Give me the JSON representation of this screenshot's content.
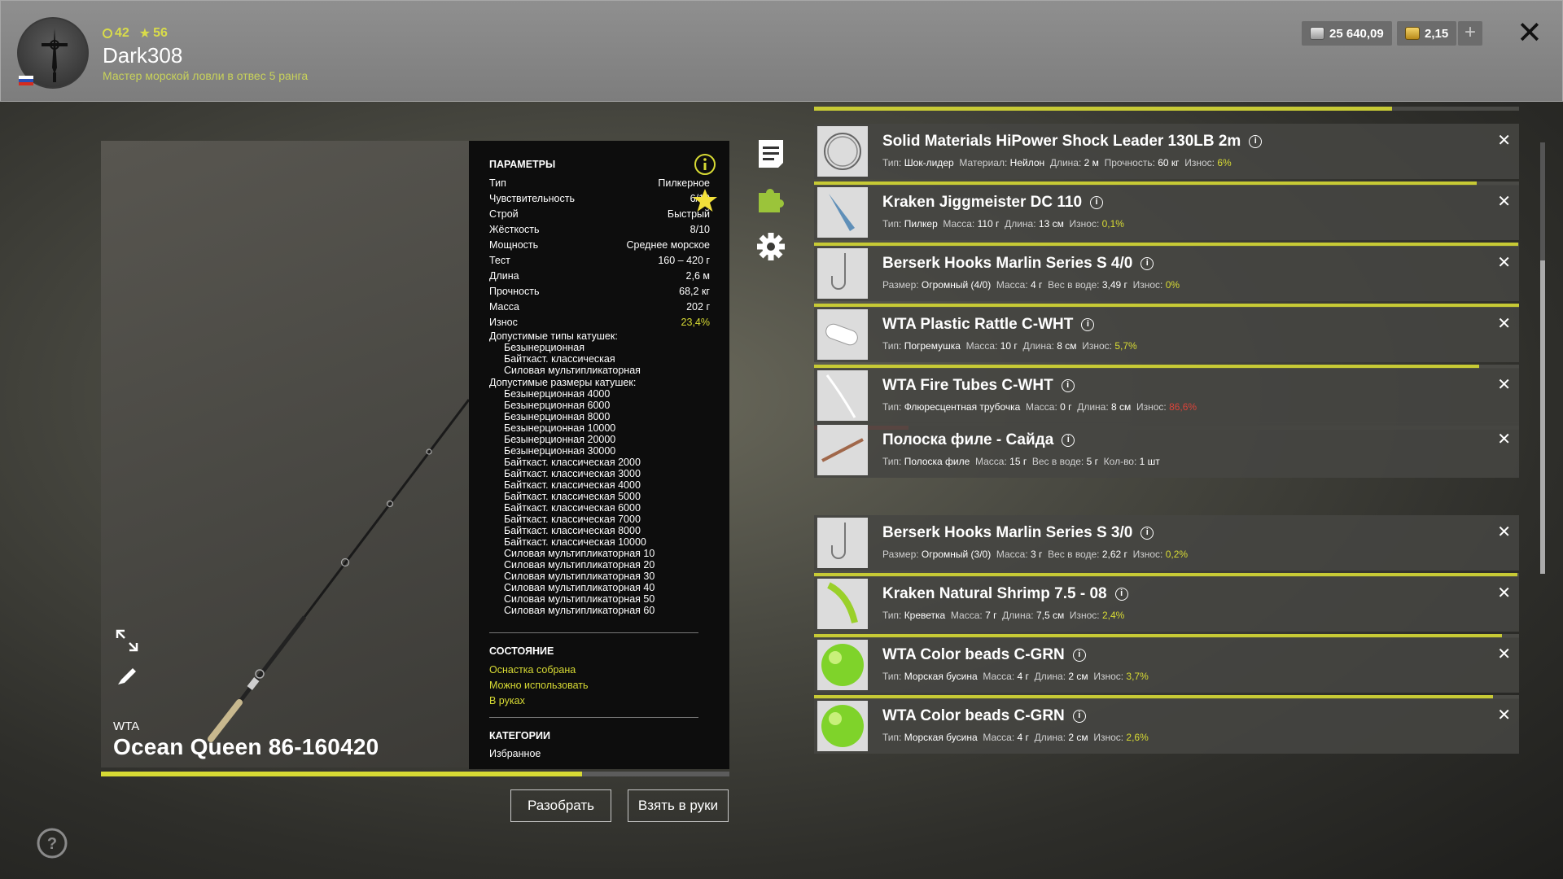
{
  "header": {
    "level": "42",
    "rating": "56",
    "username": "Dark308",
    "rank": "Мастер морской ловли в отвес 5 ранга",
    "silver": "25 640,09",
    "gold": "2,15"
  },
  "rod": {
    "brand": "WTA",
    "name": "Ocean Queen 86-160420",
    "condition_fraction": 0.766
  },
  "params": {
    "title": "ПАРАМЕТРЫ",
    "rows": [
      {
        "label": "Тип",
        "value": "Пилкерное"
      },
      {
        "label": "Чувствительность",
        "value": "6/10"
      },
      {
        "label": "Строй",
        "value": "Быстрый"
      },
      {
        "label": "Жёсткость",
        "value": "8/10"
      },
      {
        "label": "Мощность",
        "value": "Среднее морское"
      },
      {
        "label": "Тест",
        "value": "160 – 420 г"
      },
      {
        "label": "Длина",
        "value": "2,6 м"
      },
      {
        "label": "Прочность",
        "value": "68,2 кг"
      },
      {
        "label": "Масса",
        "value": "202 г"
      },
      {
        "label": "Износ",
        "value": "23,4%"
      }
    ],
    "reel_types_title": "Допустимые типы катушек:",
    "reel_types": [
      "Безынерционная",
      "Байткаст. классическая",
      "Силовая мультипликаторная"
    ],
    "reel_sizes_title": "Допустимые размеры катушек:",
    "reel_sizes": [
      "Безынерционная 4000",
      "Безынерционная 6000",
      "Безынерционная 8000",
      "Безынерционная 10000",
      "Безынерционная 20000",
      "Безынерционная 30000",
      "Байткаст. классическая 2000",
      "Байткаст. классическая 3000",
      "Байткаст. классическая 4000",
      "Байткаст. классическая 5000",
      "Байткаст. классическая 6000",
      "Байткаст. классическая 7000",
      "Байткаст. классическая 8000",
      "Байткаст. классическая 10000",
      "Силовая мультипликаторная 10",
      "Силовая мультипликаторная 20",
      "Силовая мультипликаторная 30",
      "Силовая мультипликаторная 40",
      "Силовая мультипликаторная 50",
      "Силовая мультипликаторная 60"
    ],
    "state_title": "СОСТОЯНИЕ",
    "state_items": [
      "Оснастка собрана",
      "Можно использовать",
      "В руках"
    ],
    "categories_title": "КАТЕГОРИИ",
    "category": "Избранное"
  },
  "buttons": {
    "disassemble": "Разобрать",
    "take": "Взять в руки"
  },
  "tackle": [
    {
      "name": "Solid Materials HiPower Shock Leader 130LB 2m",
      "desc": [
        [
          "Тип:",
          "Шок-лидер"
        ],
        [
          "Материал:",
          "Нейлон"
        ],
        [
          "Длина:",
          "2 м"
        ],
        [
          "Прочность:",
          "60 кг"
        ]
      ],
      "wear_label": "Износ:",
      "wear": "6%",
      "wear_color": "green",
      "condition": 0.94
    },
    {
      "name": "Kraken Jiggmeister DC 110",
      "desc": [
        [
          "Тип:",
          "Пилкер"
        ],
        [
          "Масса:",
          "110 г"
        ],
        [
          "Длина:",
          "13 см"
        ]
      ],
      "wear_label": "Износ:",
      "wear": "0,1%",
      "wear_color": "green",
      "condition": 0.999
    },
    {
      "name": "Berserk Hooks Marlin Series S 4/0",
      "desc": [
        [
          "Размер:",
          "Огромный (4/0)"
        ],
        [
          "Масса:",
          "4 г"
        ],
        [
          "Вес в воде:",
          "3,49 г"
        ]
      ],
      "wear_label": "Износ:",
      "wear": "0%",
      "wear_color": "green",
      "condition": 1.0
    },
    {
      "name": "WTA Plastic Rattle C-WHT",
      "desc": [
        [
          "Тип:",
          "Погремушка"
        ],
        [
          "Масса:",
          "10 г"
        ],
        [
          "Длина:",
          "8 см"
        ]
      ],
      "wear_label": "Износ:",
      "wear": "5,7%",
      "wear_color": "green",
      "condition": 0.943
    },
    {
      "name": "WTA Fire Tubes C-WHT",
      "desc": [
        [
          "Тип:",
          "Флюресцентная трубочка"
        ],
        [
          "Масса:",
          "0 г"
        ],
        [
          "Длина:",
          "8 см"
        ]
      ],
      "wear_label": "Износ:",
      "wear": "86,6%",
      "wear_color": "red",
      "condition": 0.134
    },
    {
      "name": "Полоска филе - Сайда",
      "desc": [
        [
          "Тип:",
          "Полоска филе"
        ],
        [
          "Масса:",
          "15 г"
        ],
        [
          "Вес в воде:",
          "5 г"
        ],
        [
          "Кол-во:",
          "1 шт"
        ]
      ],
      "wear_label": "",
      "wear": "",
      "wear_color": "green",
      "condition": null
    },
    {
      "name": "Berserk Hooks Marlin Series S 3/0",
      "desc": [
        [
          "Размер:",
          "Огромный (3/0)"
        ],
        [
          "Масса:",
          "3 г"
        ],
        [
          "Вес в воде:",
          "2,62 г"
        ]
      ],
      "wear_label": "Износ:",
      "wear": "0,2%",
      "wear_color": "green",
      "condition": 0.998
    },
    {
      "name": "Kraken Natural Shrimp 7.5 - 08",
      "desc": [
        [
          "Тип:",
          "Креветка"
        ],
        [
          "Масса:",
          "7 г"
        ],
        [
          "Длина:",
          "7,5 см"
        ]
      ],
      "wear_label": "Износ:",
      "wear": "2,4%",
      "wear_color": "green",
      "condition": 0.976
    },
    {
      "name": "WTA Color beads C-GRN",
      "desc": [
        [
          "Тип:",
          "Морская бусина"
        ],
        [
          "Масса:",
          "4 г"
        ],
        [
          "Длина:",
          "2 см"
        ]
      ],
      "wear_label": "Износ:",
      "wear": "3,7%",
      "wear_color": "green",
      "condition": 0.963
    },
    {
      "name": "WTA Color beads C-GRN",
      "desc": [
        [
          "Тип:",
          "Морская бусина"
        ],
        [
          "Масса:",
          "4 г"
        ],
        [
          "Длина:",
          "2 см"
        ]
      ],
      "wear_label": "Износ:",
      "wear": "2,6%",
      "wear_color": "green",
      "condition": null
    }
  ]
}
